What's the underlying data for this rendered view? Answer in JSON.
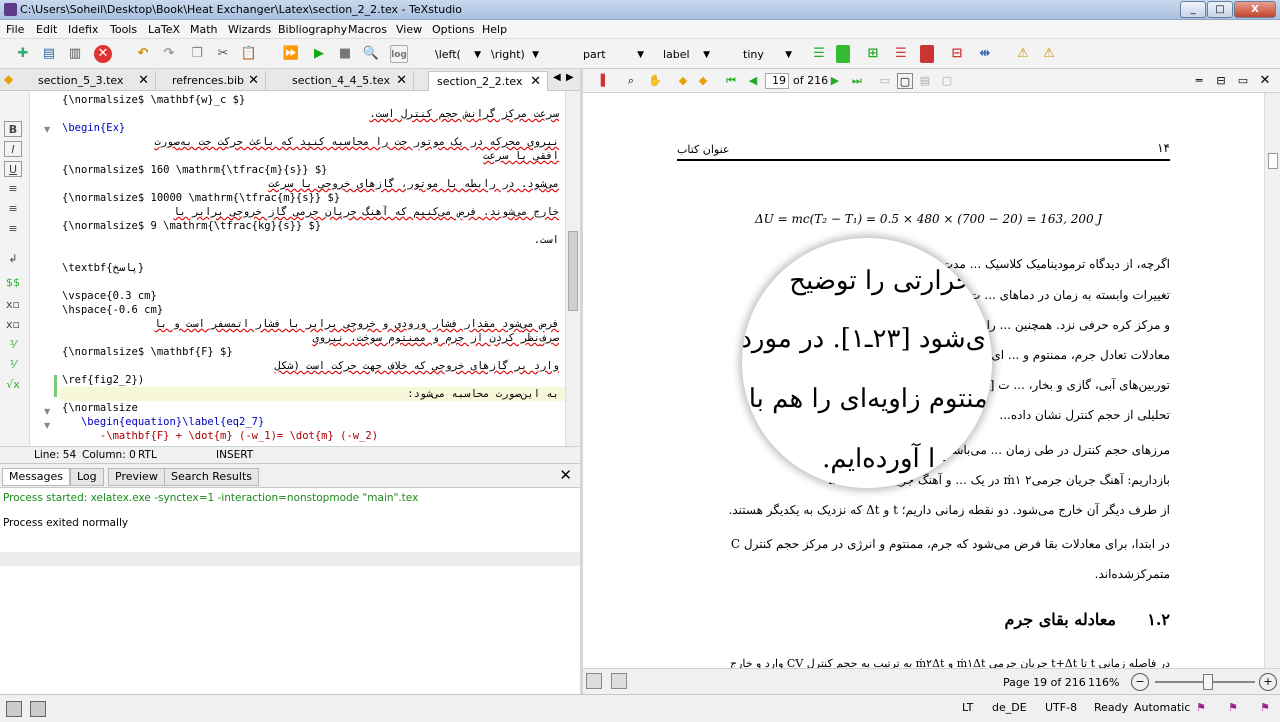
{
  "window": {
    "title": "C:\\Users\\Soheil\\Desktop\\Book\\Heat Exchanger\\Latex\\section_2_2.tex - TeXstudio",
    "min": "_",
    "max": "□",
    "close": "X"
  },
  "menu": [
    "File",
    "Edit",
    "Idefix",
    "Tools",
    "LaTeX",
    "Math",
    "Wizards",
    "Bibliography",
    "Macros",
    "View",
    "Options",
    "Help"
  ],
  "toolbar": {
    "left_combo": "\\left(",
    "right_combo": "\\right)",
    "part": "part",
    "label": "label",
    "size": "tiny"
  },
  "tabs": [
    {
      "label": "section_5_3.tex"
    },
    {
      "label": "refrences.bib"
    },
    {
      "label": "section_4_4_5.tex"
    },
    {
      "label": "section_2_2.tex"
    }
  ],
  "editor": {
    "lines": [
      "{\\normalsize$ \\mathbf{w}_c $}",
      "سرعت مرکز گرانش حجم کنترل است.",
      "\\begin{Ex}",
      "نیروی محرکه در یک موتور جت را محاسبه کنید که باعث حرکت جت به‌صورت",
      "افقی با سرعت",
      "{\\normalsize$ 160 \\mathrm{\\tfrac{m}{s}} $}",
      "می‌شود. در رابطه با موتور، گازهای خروجی با سرعت",
      "{\\normalsize$ 10000 \\mathrm{\\tfrac{m}{s}} $}",
      "خارج می‌شوند. فرض می‌کنیم که آهنگ جریان جرمی گاز خروجی برابر با",
      "{\\normalsize$ 9 \\mathrm{\\tfrac{kg}{s}} $}",
      "است.",
      "",
      "\\textbf{پاسخ}",
      "",
      "\\vspace{0.3 cm}",
      "\\hspace{-0.6 cm}",
      "فرض می‌شود مقدار فشار ورودی و خروجی برابر با فشار اتمسفر است و با",
      "صرف‌نظر کردن از جرم و ممنتوم سوخت، نیروی",
      "{\\normalsize$ \\mathbf{F} $}",
      "وارد بر گازهای خروجی که خلاف جهت حرکت است (شکل",
      "\\ref{fig2_2})",
      "به این‌صورت محاسبه می‌شود:",
      "{\\normalsize",
      "   \\begin{equation}\\label{eq2_7}",
      "      -\\mathbf{F} + \\dot{m} (-w_1)= \\dot{m} (-w_2)"
    ]
  },
  "editor_status": {
    "line": "Line: 54",
    "column": "Column: 0",
    "dir": "RTL",
    "mode": "INSERT"
  },
  "messages": {
    "tabs": [
      "Messages",
      "Log",
      "Preview",
      "Search Results"
    ],
    "lines": [
      "Process started: xelatex.exe -synctex=1 -interaction=nonstopmode \"main\".tex",
      "Process exited normally"
    ]
  },
  "pdf": {
    "page_input": "19",
    "page_of": "of 216",
    "header_right": "۱۴",
    "header_left": "عنوان کتاب",
    "equation": "ΔU = mc(T₂ − T₁) = 0.5 × 480 × (700 − 20) = 163, 200 J",
    "para1": [
      "اگرچه، از دیدگاه ترمودینامیک کلاسیک ... مدت فرآیند یا در مورد",
      "تغییرات وابسته به زمان در دماهای ... ت دما میان سطح",
      "و مرکز کره حرفی نزد. همچنین ... رات بر اساس",
      "معادلات تعادل جرم، ممنتوم و ... ای۱، فن‌ها و",
      "توربین‌های آبی، گازی و بخار، ... ت [۲۷ـ۲۴].",
      "تحلیلی از حجم کنترل نشان داده..."
    ],
    "para2": [
      "مرزهای حجم کنترل در طی زمان ... می‌باشند. در سیستم",
      "بازداریم: آهنگ جریان جرمی۲ ṁ۱ در یک ... و آهنگ جریان جرمی ṁ۲",
      "از طرف دیگر آن خارج می‌شود. دو نقطه زمانی داریم؛ t و Δt که نزدیک به یکدیگر هستند."
    ],
    "para3": [
      "در ابتدا، برای معادلات بقا فرض می‌شود که جرم، ممنتوم و انرژی در مرکز حجم کنترل C",
      "متمرکزشده‌اند."
    ],
    "section_num": "۱.۲",
    "section_title": "معادله بقای جرم",
    "last_line": "در فاصله زمانی t تا t+Δt جریان جرمی ṁ۱Δt و ṁ۲Δt به ترتیب به حجم کنترل CV وارد و خارج",
    "mag": [
      "حرارتی را توضیح",
      "ی‌شود [۲۳ـ۱]. در مورد",
      "منتوم زاویه‌ای را هم باید",
      "۱ را آورده‌ایم."
    ],
    "status_page": "Page 19 of 216",
    "zoom": "116%"
  },
  "statusbar": {
    "lang": "de_DE",
    "enc": "UTF-8",
    "ready": "Ready",
    "auto": "Automatic",
    "lt": "LT"
  }
}
